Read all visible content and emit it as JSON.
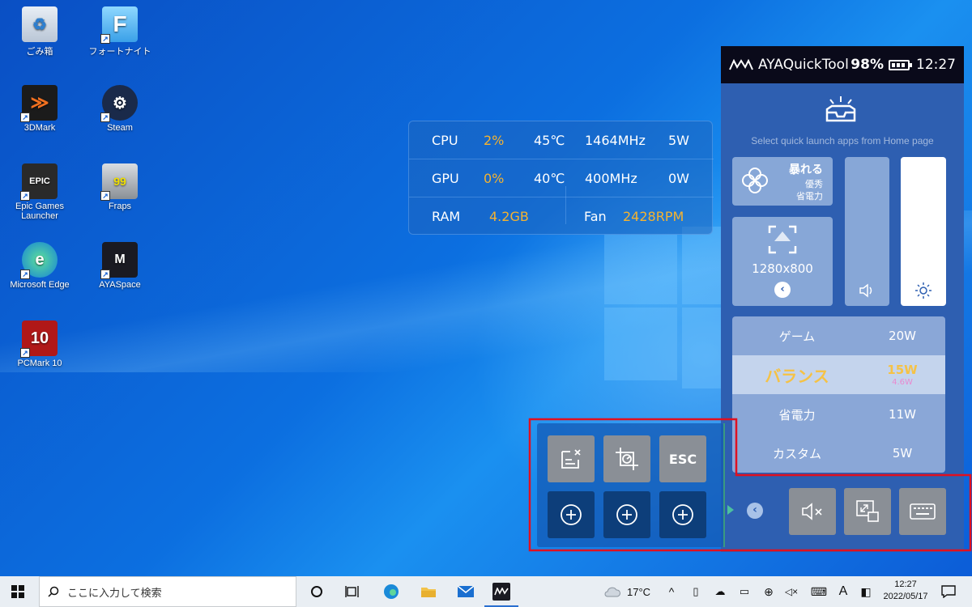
{
  "desktop": {
    "icons": [
      {
        "label": "ごみ箱"
      },
      {
        "label": "フォートナイト"
      },
      {
        "label": "3DMark"
      },
      {
        "label": "Steam"
      },
      {
        "label": "Epic Games Launcher"
      },
      {
        "label": "Fraps"
      },
      {
        "label": "Microsoft Edge"
      },
      {
        "label": "AYASpace"
      },
      {
        "label": "PCMark 10"
      }
    ]
  },
  "overlay": {
    "cpu": {
      "label": "CPU",
      "usage": "2%",
      "temp": "45℃",
      "clock": "1464MHz",
      "power": "5W"
    },
    "gpu": {
      "label": "GPU",
      "usage": "0%",
      "temp": "40℃",
      "clock": "400MHz",
      "power": "0W"
    },
    "ram": {
      "label": "RAM",
      "value": "4.2GB"
    },
    "fan": {
      "label": "Fan",
      "value": "2428RPM"
    }
  },
  "aya": {
    "title": "AYAQuickTool",
    "battery": "98%",
    "time": "12:27",
    "hint": "Select quick launch apps from Home page",
    "fan_tile": {
      "title": "暴れる",
      "line1": "優秀",
      "line2": "省電力"
    },
    "resolution": "1280x800",
    "modes": [
      {
        "name": "ゲーム",
        "power": "20W"
      },
      {
        "name": "バランス",
        "power": "15W",
        "sub": "4.6W"
      },
      {
        "name": "省電力",
        "power": "11W"
      },
      {
        "name": "カスタム",
        "power": "5W"
      }
    ]
  },
  "quick_panel": {
    "esc_label": "ESC"
  },
  "taskbar": {
    "search_placeholder": "ここに入力して検索",
    "weather": "17°C",
    "ime": "A",
    "clock_time": "12:27",
    "clock_date": "2022/05/17"
  },
  "colors": {
    "accent_orange": "#f5b330",
    "highlight_red": "#e01020",
    "panel_blue": "#2e5fb1"
  }
}
